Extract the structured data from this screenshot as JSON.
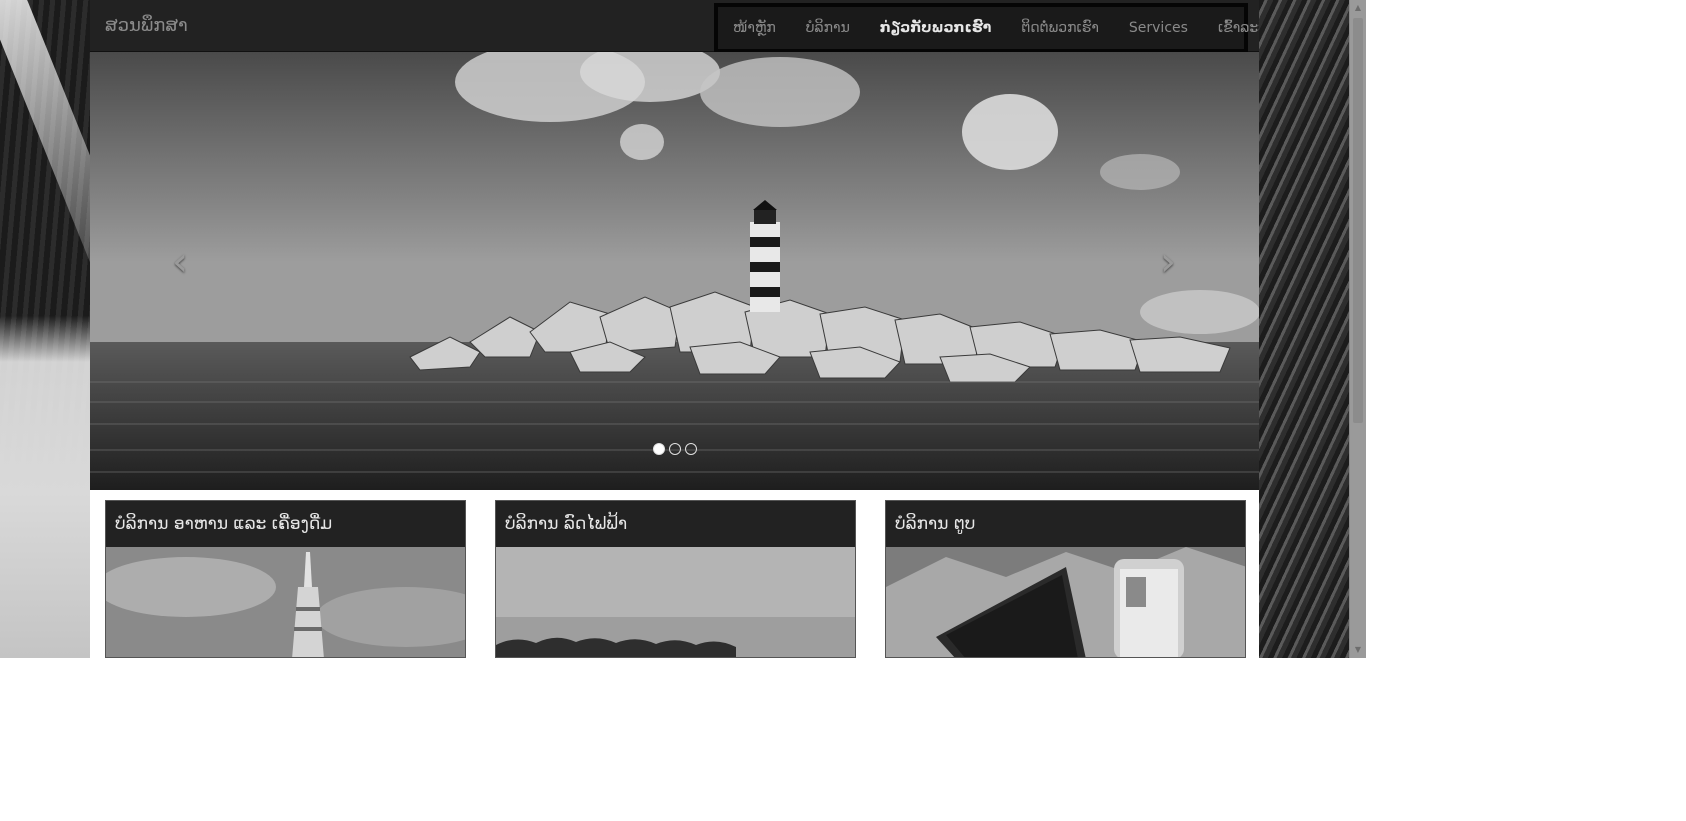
{
  "site": {
    "brand": "ສວນພຶກສາ"
  },
  "nav": {
    "items": [
      {
        "label": "ໜ້າຫຼັກ",
        "active": false
      },
      {
        "label": "ບໍລິການ",
        "active": false
      },
      {
        "label": "ກ່ຽວກັບພວກເຮົາ",
        "active": true
      },
      {
        "label": "ຕິດຕໍ່ພວກເຮົາ",
        "active": false
      },
      {
        "label": "Services",
        "active": false
      },
      {
        "label": "ເຂົ້າລະບົບ",
        "active": false
      }
    ]
  },
  "carousel": {
    "prev_icon": "chevron-left-icon",
    "next_icon": "chevron-right-icon",
    "prev_glyph": "‹",
    "next_glyph": "›",
    "slide_count": 3,
    "active_slide": 1
  },
  "cards": [
    {
      "title": "ບໍລິການ ອາຫານ ແລະ ເຄື່ອງດື່ມ"
    },
    {
      "title": "ບໍລິການ ລົດໄຟຟ້າ"
    },
    {
      "title": "ບໍລິການ ຕູບ"
    }
  ],
  "colors": {
    "navbar": "#222222",
    "nav_text": "#8a8a8a",
    "nav_active_text": "#e6e6e6",
    "card_title_bg": "#222222",
    "page_bg": "#ffffff"
  }
}
